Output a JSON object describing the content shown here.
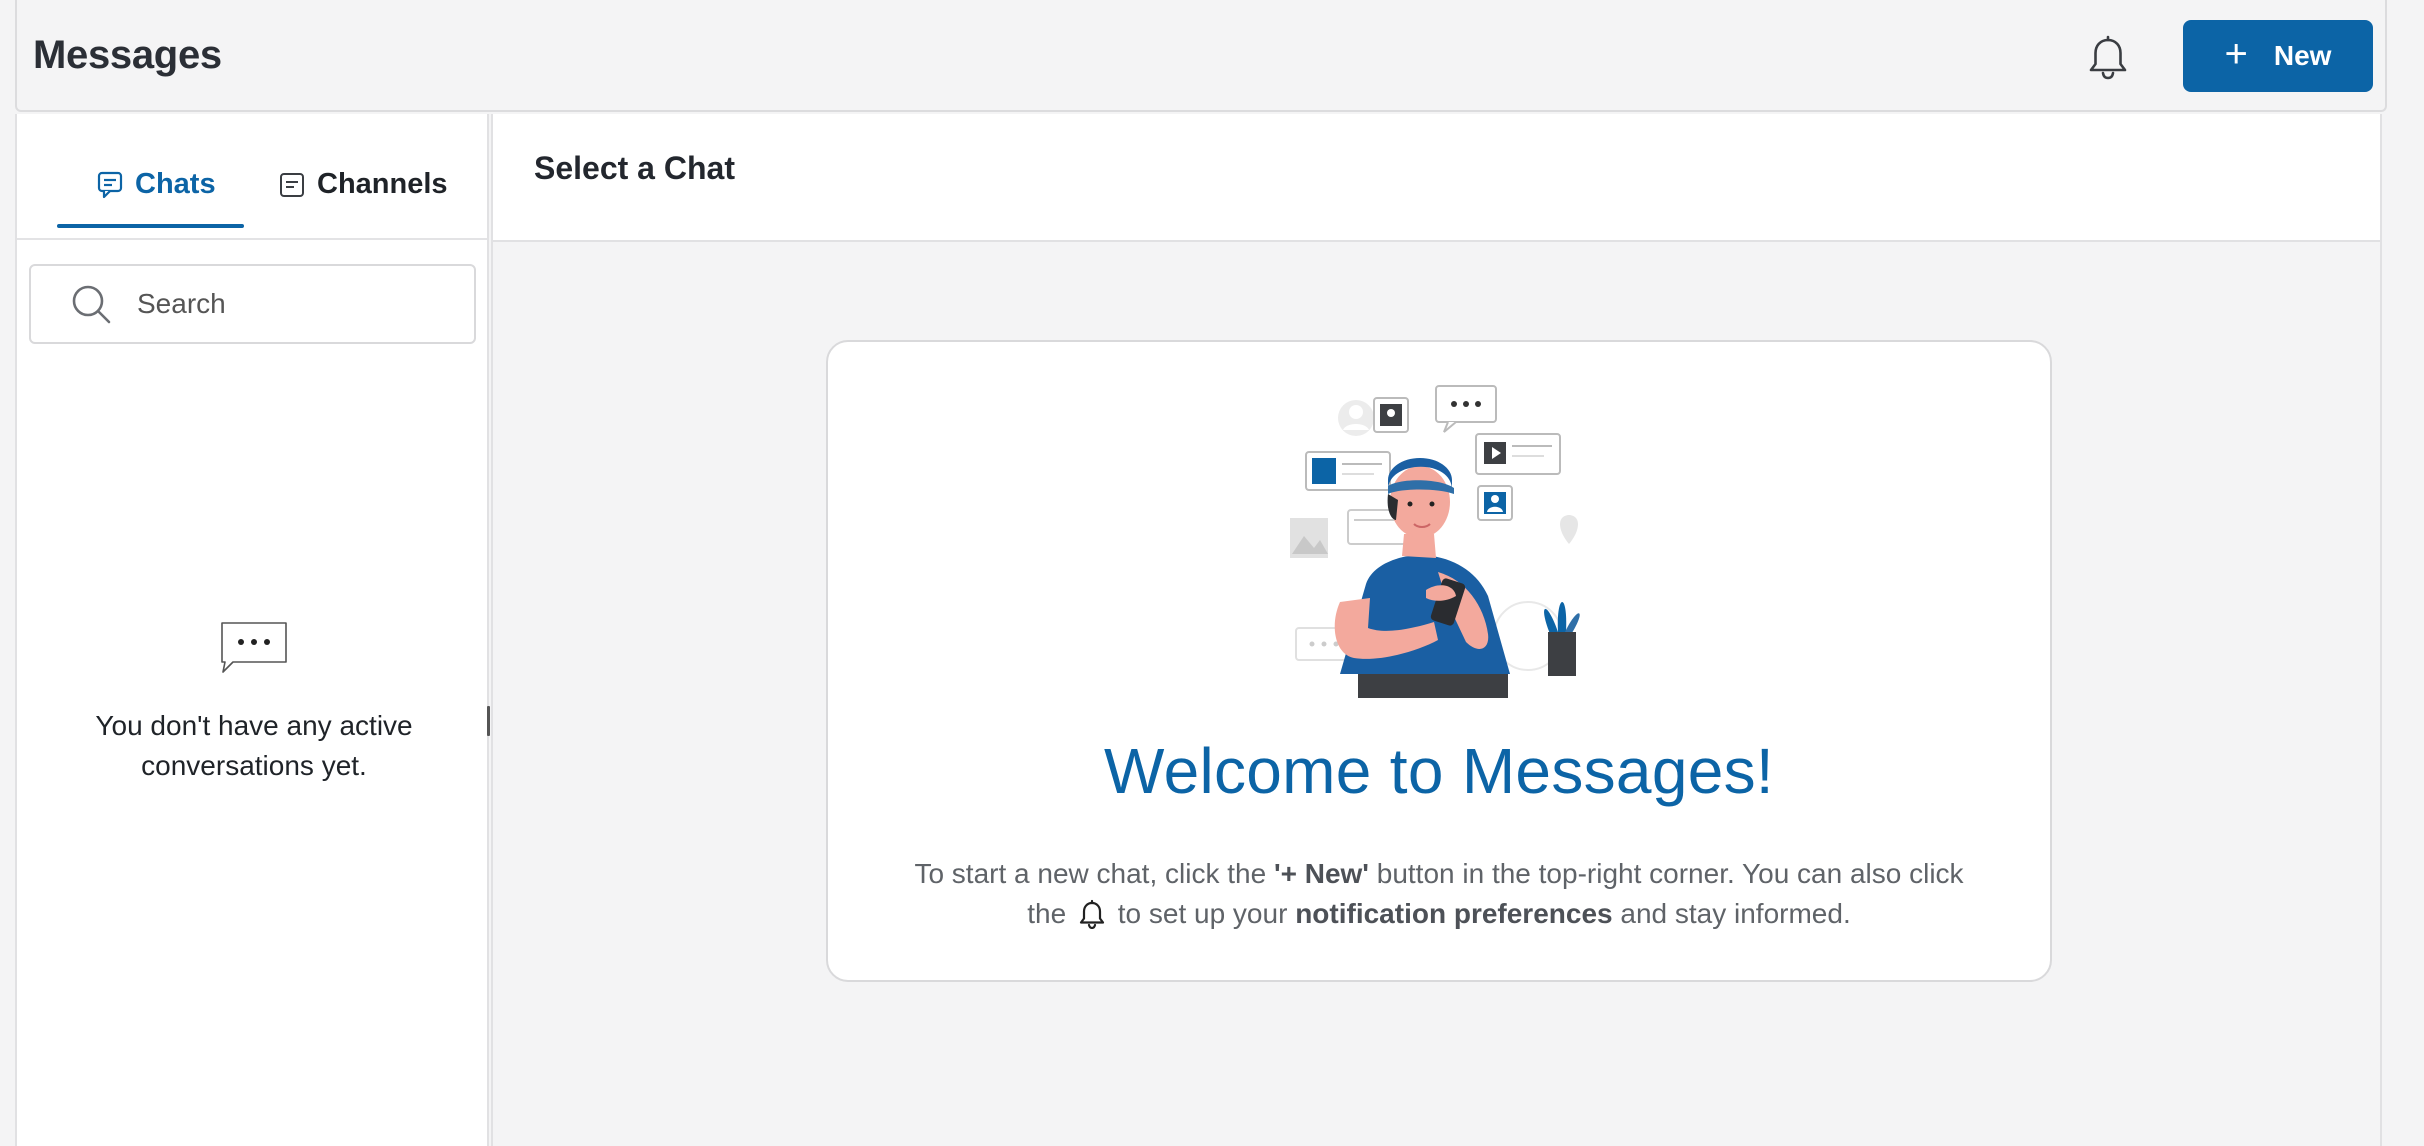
{
  "header": {
    "title": "Messages",
    "bell_icon": "bell-icon",
    "new_button": {
      "plus": "+",
      "label": "New"
    }
  },
  "sidebar": {
    "tabs": [
      {
        "label": "Chats",
        "icon": "chat-bubble-icon",
        "active": true
      },
      {
        "label": "Channels",
        "icon": "channel-icon",
        "active": false
      }
    ],
    "search": {
      "placeholder": "Search",
      "value": ""
    },
    "empty_state": {
      "icon": "speech-bubble-dots-icon",
      "text": "You don't have any active conversations yet."
    }
  },
  "main": {
    "title": "Select a Chat",
    "welcome": {
      "heading": "Welcome to Messages!",
      "line1_pre": "To start a new chat, click the ",
      "line1_bold": "'+ New'",
      "line1_post": " button in the top-right corner. You can also click",
      "line2_pre": "the ",
      "line2_mid": " to set up your ",
      "line2_bold": "notification preferences",
      "line2_post": " and stay informed."
    }
  },
  "colors": {
    "accent": "#0c64a6",
    "background": "#f4f4f5",
    "card": "#ffffff"
  }
}
